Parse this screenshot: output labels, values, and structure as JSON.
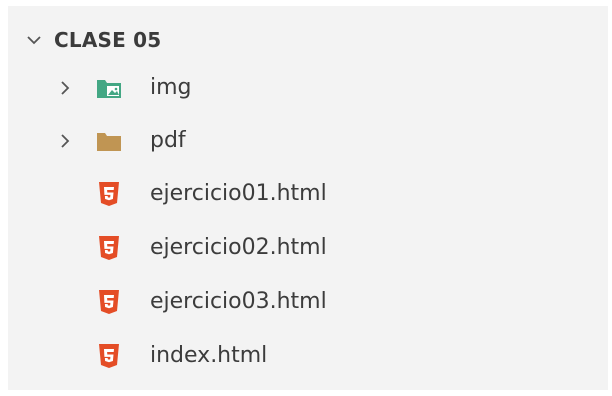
{
  "explorer": {
    "section_title": "CLASE 05",
    "section_chevron_icon": "chevron-down-icon",
    "items": [
      {
        "label": "img",
        "kind": "folder",
        "icon": "folder-images-icon",
        "collapsed": true
      },
      {
        "label": "pdf",
        "kind": "folder",
        "icon": "folder-icon",
        "collapsed": true
      },
      {
        "label": "ejercicio01.html",
        "kind": "file",
        "icon": "html5-icon"
      },
      {
        "label": "ejercicio02.html",
        "kind": "file",
        "icon": "html5-icon"
      },
      {
        "label": "ejercicio03.html",
        "kind": "file",
        "icon": "html5-icon"
      },
      {
        "label": "index.html",
        "kind": "file",
        "icon": "html5-icon"
      }
    ]
  },
  "colors": {
    "panel_background": "#f3f3f3",
    "text": "#3c3c3c",
    "html5_orange": "#e44d26",
    "img_folder_green": "#43a784",
    "pdf_folder_tan": "#c09553"
  }
}
